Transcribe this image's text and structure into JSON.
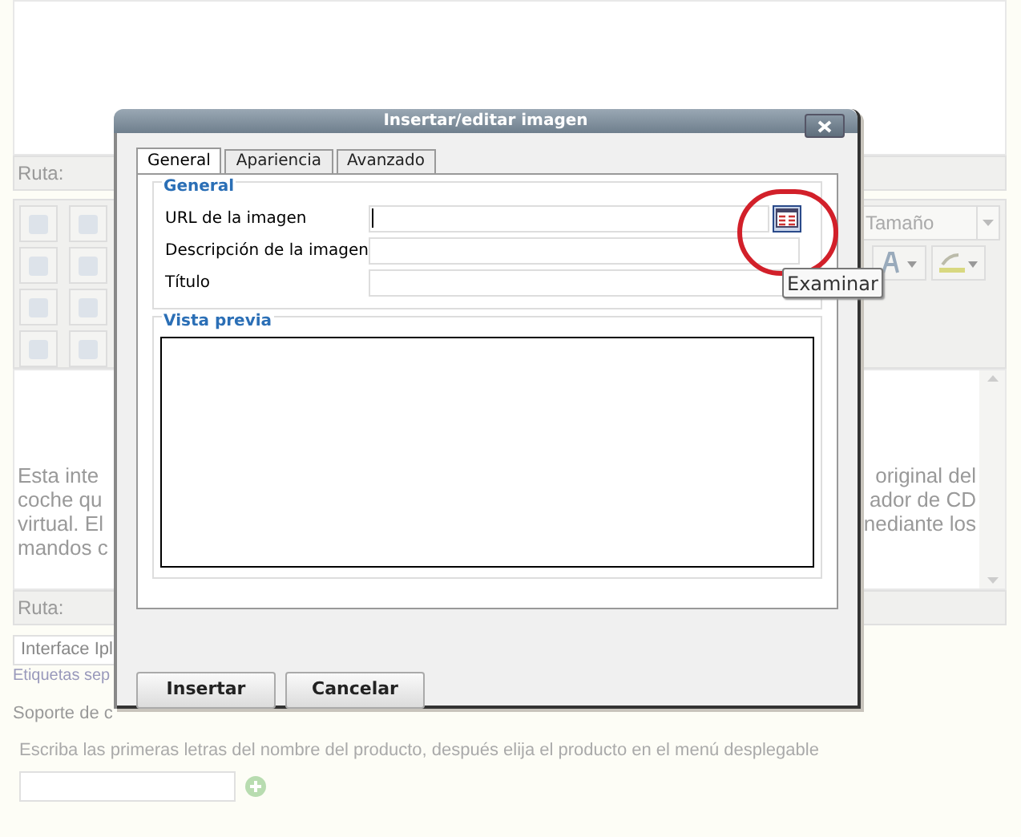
{
  "editor": {
    "path_label": "Ruta:",
    "font_size": {
      "placeholder": "Tamaño"
    },
    "content_left": [
      "Esta inte",
      "coche qu",
      "virtual. El",
      "mandos c"
    ],
    "content_right": [
      "original del",
      "ador de CD",
      "nediante los"
    ],
    "path_label_bottom": "Ruta:"
  },
  "tags_field": {
    "value": "Interface Ipl"
  },
  "tags_hint": "Etiquetas sep",
  "support_label": "Soporte de c",
  "product_hint": "Escriba las primeras letras del nombre del producto, después elija el producto en el menú desplegable",
  "dialog": {
    "title": "Insertar/editar imagen",
    "tabs": [
      {
        "label": "General",
        "selected": true
      },
      {
        "label": "Apariencia",
        "selected": false
      },
      {
        "label": "Avanzado",
        "selected": false
      }
    ],
    "general_legend": "General",
    "fields": [
      {
        "label": "URL de la imagen",
        "focused": true,
        "browse": true
      },
      {
        "label": "Descripción de la imagen",
        "focused": false,
        "browse": false
      },
      {
        "label": "Título",
        "focused": false,
        "browse": false
      }
    ],
    "tooltip": "Examinar",
    "preview_legend": "Vista previa",
    "buttons": [
      "Insertar",
      "Cancelar"
    ]
  }
}
